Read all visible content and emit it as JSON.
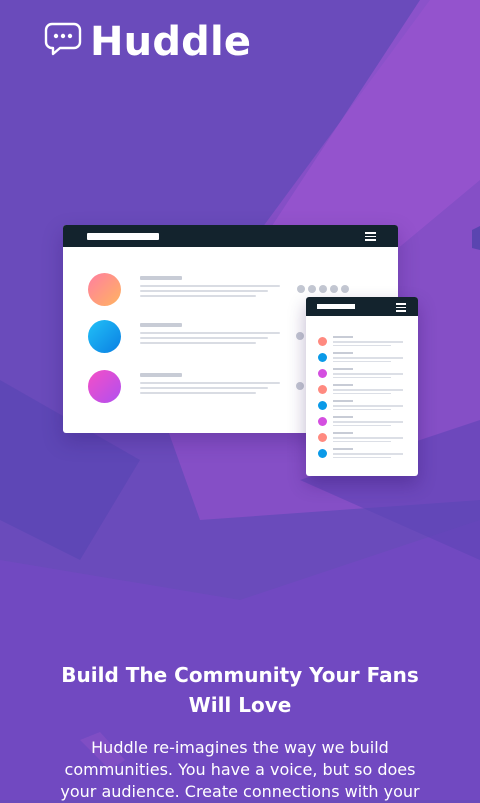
{
  "brand": {
    "name": "Huddle",
    "icon": "speech-bubble-icon"
  },
  "colors": {
    "background": "#6a4bbb",
    "accent_light": "#9a55d0",
    "mock_bar": "#13232d",
    "avatar_orange": "#ff9a76",
    "avatar_blue": "#0b9ae8",
    "avatar_magenta": "#d44fe0"
  },
  "hero": {
    "headline": "Build The Community Your Fans Will Love",
    "description": "Huddle re-imagines the way we build communities. You have a voice, but so does your audience. Create connections with your"
  },
  "illustration": {
    "main_rows": [
      "avatar_orange",
      "avatar_blue",
      "avatar_magenta"
    ],
    "side_rows": [
      "avatar_orange",
      "avatar_blue",
      "avatar_magenta",
      "avatar_orange",
      "avatar_blue",
      "avatar_magenta",
      "avatar_orange",
      "avatar_blue"
    ]
  }
}
